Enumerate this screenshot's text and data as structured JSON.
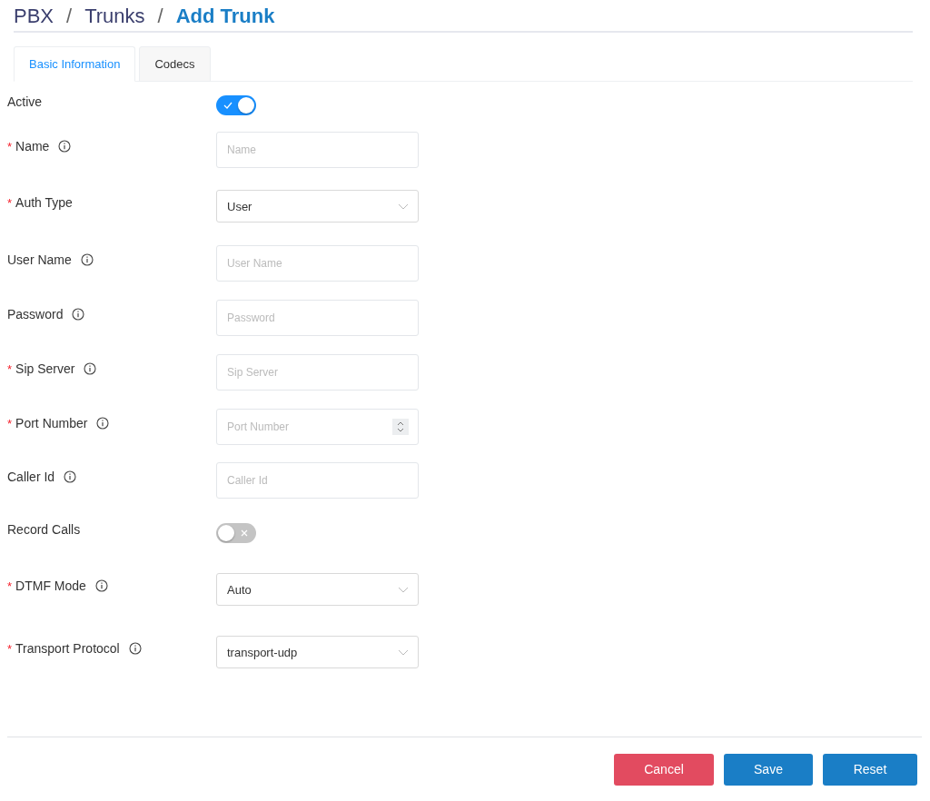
{
  "breadcrumb": {
    "separator": "/",
    "items": [
      {
        "label": "PBX",
        "selected": false
      },
      {
        "label": "Trunks",
        "selected": false
      },
      {
        "label": "Add Trunk",
        "selected": true
      }
    ]
  },
  "required_mark": "*",
  "tabs": [
    {
      "label": "Basic Information",
      "selected": true
    },
    {
      "label": "Codecs",
      "selected": false
    }
  ],
  "fields": [
    {
      "kind": "toggle",
      "label": "Active",
      "required": false,
      "info": false,
      "on": true
    },
    {
      "kind": "input",
      "label": "Name",
      "required": true,
      "info": true,
      "placeholder": "Name"
    },
    {
      "kind": "select",
      "label": "Auth Type",
      "required": true,
      "info": false,
      "value": "User"
    },
    {
      "kind": "input",
      "label": "User Name",
      "required": false,
      "info": true,
      "placeholder": "User Name"
    },
    {
      "kind": "input",
      "label": "Password",
      "required": false,
      "info": true,
      "placeholder": "Password"
    },
    {
      "kind": "input",
      "label": "Sip Server",
      "required": true,
      "info": true,
      "placeholder": "Sip Server"
    },
    {
      "kind": "number",
      "label": "Port Number",
      "required": true,
      "info": true,
      "placeholder": "Port Number"
    },
    {
      "kind": "input",
      "label": "Caller Id",
      "required": false,
      "info": true,
      "placeholder": "Caller Id"
    },
    {
      "kind": "toggle",
      "label": "Record Calls",
      "required": false,
      "info": false,
      "on": false
    },
    {
      "kind": "select",
      "label": "DTMF Mode",
      "required": true,
      "info": true,
      "value": "Auto"
    },
    {
      "kind": "select",
      "label": "Transport Protocol",
      "required": true,
      "info": true,
      "value": "transport-udp"
    }
  ],
  "buttons": [
    {
      "label": "Cancel",
      "kind": "danger"
    },
    {
      "label": "Save",
      "kind": "primary"
    },
    {
      "label": "Reset",
      "kind": "primary"
    }
  ]
}
